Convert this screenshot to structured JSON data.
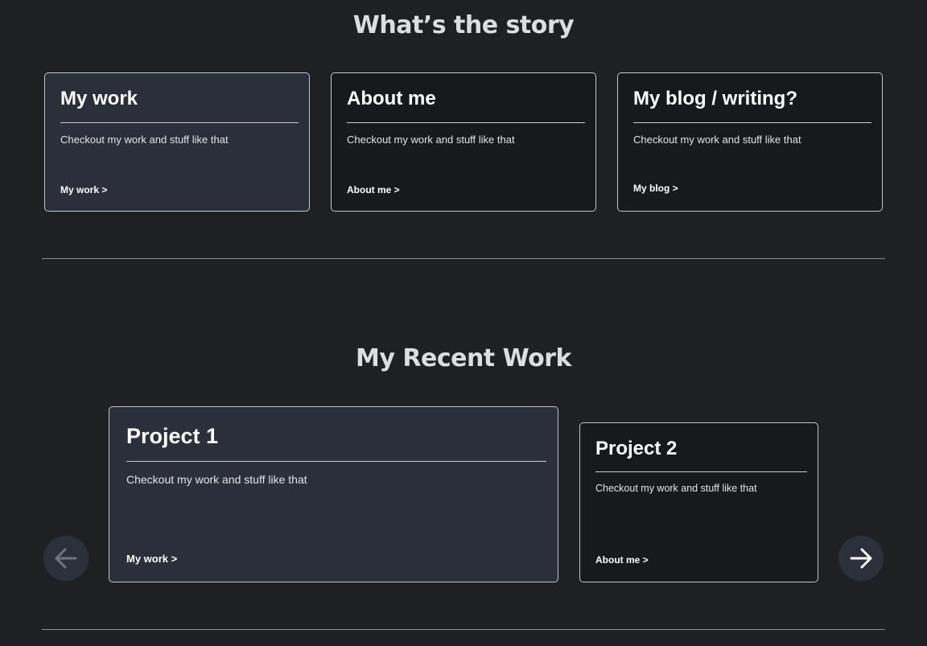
{
  "story": {
    "title": "What’s the story",
    "cards": [
      {
        "title": "My work",
        "desc": "Checkout my work and stuff like that",
        "link": "My work  >"
      },
      {
        "title": "About me",
        "desc": "Checkout my work and stuff like that",
        "link": "About me >"
      },
      {
        "title": "My blog / writing?",
        "desc": "Checkout my work and stuff like that",
        "link": "My blog >"
      }
    ]
  },
  "recent": {
    "title": "My Recent Work",
    "projects": [
      {
        "title": "Project 1",
        "desc": "Checkout my work and stuff like that",
        "link": "My work  >"
      },
      {
        "title": "Project 2",
        "desc": "Checkout my work and stuff like that",
        "link": "About me >"
      }
    ],
    "prev_icon": "arrow-left-icon",
    "next_icon": "arrow-right-icon"
  },
  "colors": {
    "background": "#1f2023",
    "card_dark": "#17191d",
    "card_highlight": "#2a2f39",
    "nav_button": "#2c303a"
  }
}
